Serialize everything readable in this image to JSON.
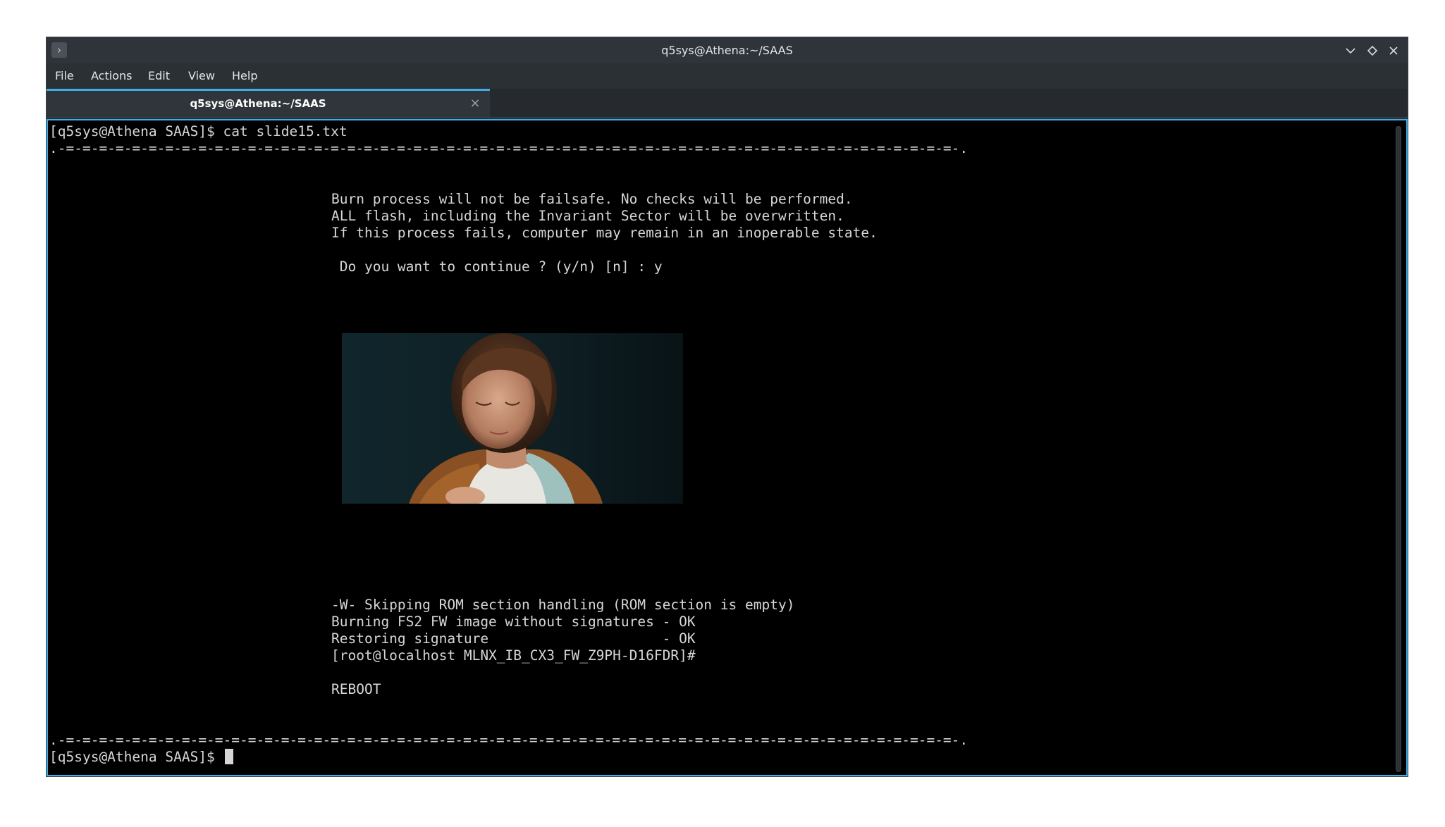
{
  "window": {
    "title": "q5sys@Athena:~/SAAS",
    "icons": {
      "app": "terminal-prompt-icon",
      "minimize": "chevron-down-icon",
      "maximize": "diamond-icon",
      "close": "close-icon"
    }
  },
  "menu": {
    "items": [
      "File",
      "Actions",
      "Edit",
      "View",
      "Help"
    ]
  },
  "tabs": [
    {
      "label": "q5sys@Athena:~/SAAS",
      "active": true
    }
  ],
  "terminal": {
    "command_line": "[q5sys@Athena SAAS]$ cat slide15.txt",
    "separator": ".-=-=-=-=-=-=-=-=-=-=-=-=-=-=-=-=-=-=-=-=-=-=-=-=-=-=-=-=-=-=-=-=-=-=-=-=-=-=-=-=-=-=-=-=-=-=-=-=-=-=-=-=-=-=-.",
    "warning_lines": [
      "Burn process will not be failsafe. No checks will be performed.",
      "ALL flash, including the Invariant Sector will be overwritten.",
      "If this process fails, computer may remain in an inoperable state."
    ],
    "prompt_question": " Do you want to continue ? (y/n) [n] : y",
    "output_lines": [
      "-W- Skipping ROM section handling (ROM section is empty)",
      "Burning FS2 FW image without signatures - OK",
      "Restoring signature                     - OK",
      "[root@localhost MLNX_IB_CX3_FW_Z9PH-D16FDR]#"
    ],
    "reboot": "REBOOT",
    "final_prompt": "[q5sys@Athena SAAS]$ "
  },
  "colors": {
    "accent": "#3daee9",
    "terminal_bg": "#000000",
    "terminal_fg": "#d6d6d6",
    "chrome_bg": "#2b3035"
  }
}
